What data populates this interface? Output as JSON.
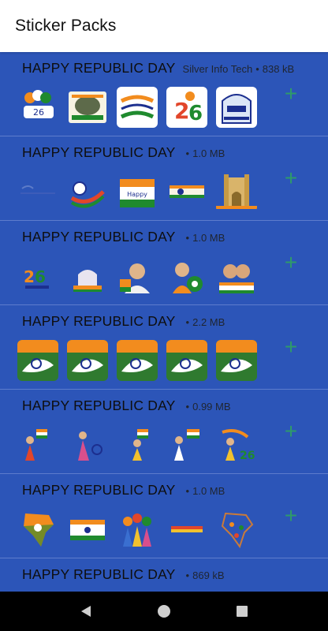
{
  "app": {
    "title": "Sticker Packs"
  },
  "packs": [
    {
      "name": "HAPPY REPUBLIC DAY",
      "publisher": "Silver Info Tech",
      "size": "838 kB"
    },
    {
      "name": "HAPPY REPUBLIC DAY",
      "publisher": "",
      "size": "1.0 MB"
    },
    {
      "name": "HAPPY REPUBLIC DAY",
      "publisher": "",
      "size": "1.0 MB"
    },
    {
      "name": "HAPPY REPUBLIC DAY",
      "publisher": "",
      "size": "2.2 MB"
    },
    {
      "name": "HAPPY REPUBLIC DAY",
      "publisher": "",
      "size": "0.99 MB"
    },
    {
      "name": "HAPPY REPUBLIC DAY",
      "publisher": "",
      "size": "1.0 MB"
    },
    {
      "name": "HAPPY REPUBLIC DAY",
      "publisher": "",
      "size": "869 kB"
    }
  ],
  "icons": {
    "add": "plus-icon",
    "back": "back-icon",
    "home": "home-icon",
    "recents": "recents-icon"
  },
  "colors": {
    "list_bg": "#2c55b8",
    "add": "#2e9a6a",
    "saffron": "#f28c1e",
    "green": "#1f8a2e",
    "navy": "#1c2f8f"
  }
}
